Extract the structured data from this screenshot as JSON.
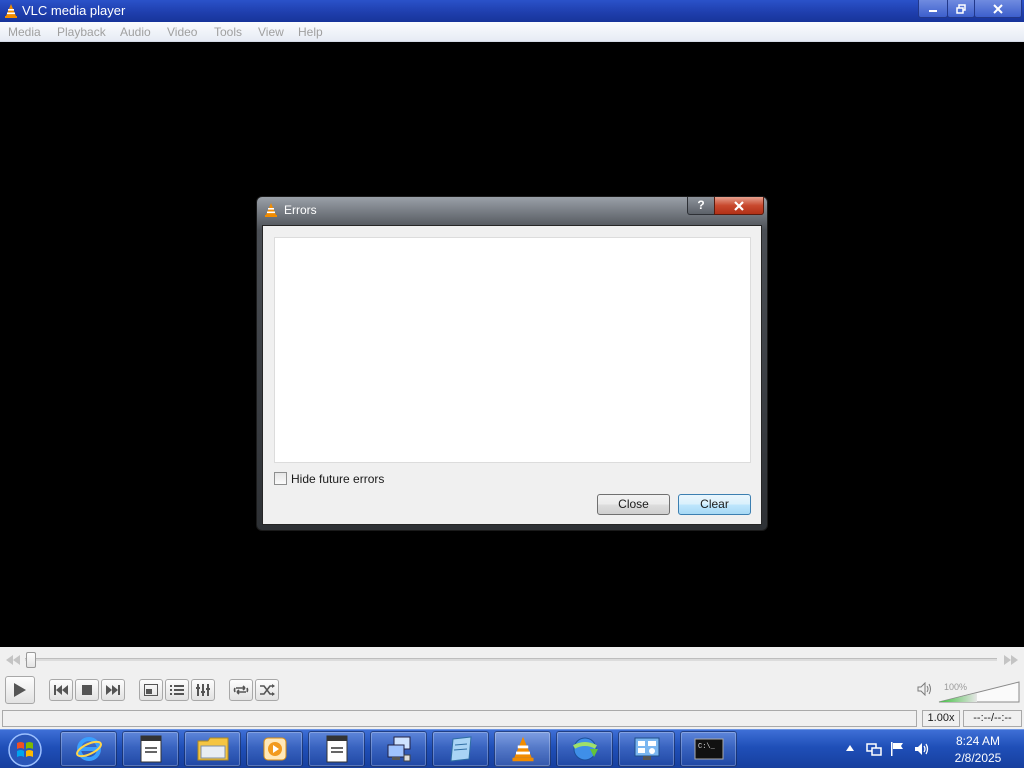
{
  "window": {
    "title": "VLC media player",
    "icon": "vlc-cone-icon"
  },
  "menu": {
    "items": [
      "Media",
      "Playback",
      "Audio",
      "Video",
      "Tools",
      "View",
      "Help"
    ]
  },
  "dialog": {
    "title": "Errors",
    "help_glyph": "?",
    "checkbox_label": "Hide future errors",
    "checkbox_checked": false,
    "close_label": "Close",
    "clear_label": "Clear"
  },
  "controls": {
    "seek_position": 0,
    "buttons": [
      "play-icon",
      "previous-icon",
      "stop-icon",
      "next-icon",
      "fullscreen-icon",
      "playlist-icon",
      "extended-settings-icon",
      "loop-icon",
      "shuffle-icon"
    ],
    "volume_label": "100%",
    "volume_level": 100,
    "speed": "1.00x",
    "time": "--:--/--:--"
  },
  "taskbar": {
    "items": [
      "internet-explorer-icon",
      "document-window-icon",
      "file-explorer-icon",
      "media-center-icon",
      "document-window-icon",
      "network-computer-icon",
      "notepad-icon",
      "vlc-cone-icon",
      "download-manager-icon",
      "control-panel-icon",
      "command-prompt-icon"
    ],
    "active_index": 7,
    "clock_time": "8:24 AM",
    "clock_date": "2/8/2025"
  },
  "colors": {
    "titlebar": "#1f3fae",
    "taskbar": "#1f4fb8",
    "vlc_orange": "#f28c00",
    "clear_button": "#bee6fd"
  }
}
